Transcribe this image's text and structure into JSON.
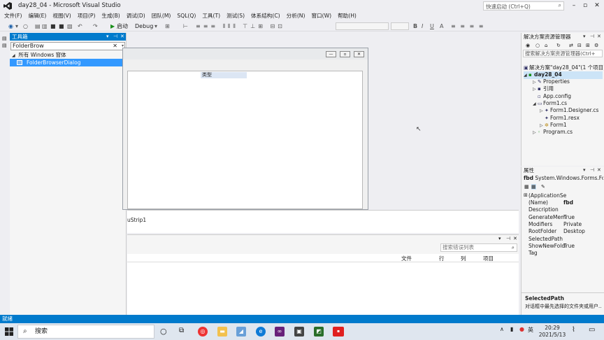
{
  "window": {
    "title": "day28_04 - Microsoft Visual Studio",
    "quick_launch_placeholder": "快速启动 (Ctrl+Q)"
  },
  "menu": [
    "文件(F)",
    "编辑(E)",
    "视图(V)",
    "项目(P)",
    "生成(B)",
    "调试(D)",
    "团队(M)",
    "SQL(Q)",
    "工具(T)",
    "测试(S)",
    "体系结构(C)",
    "分析(N)",
    "窗口(W)",
    "帮助(H)"
  ],
  "toolbar": {
    "start_label": "启动",
    "config": "Debug"
  },
  "toolbox": {
    "title": "工具箱",
    "search_value": "FolderBrow",
    "group": "所有 Windows 窗体",
    "item": "FolderBrowserDialog"
  },
  "designer": {
    "column_header": "类型",
    "component": "uStrip1"
  },
  "error_list": {
    "search_placeholder": "搜索错误列表",
    "columns": [
      "文件",
      "行",
      "列",
      "项目"
    ]
  },
  "solution_explorer": {
    "title": "解决方案资源管理器",
    "search_placeholder": "搜索解决方案资源管理器(Ctrl+",
    "items": [
      "解决方案\"day28_04\"(1 个项目)",
      "day28_04",
      "Properties",
      "引用",
      "App.config",
      "Form1.cs",
      "Form1.Designer.cs",
      "Form1.resx",
      "Form1",
      "Program.cs"
    ]
  },
  "properties": {
    "title": "属性",
    "object": "fbd",
    "object_type": "System.Windows.Forms.Fol",
    "rows": [
      {
        "name": "(ApplicationSe",
        "value": ""
      },
      {
        "name": "(Name)",
        "value": "fbd"
      },
      {
        "name": "Description",
        "value": ""
      },
      {
        "name": "GenerateMem",
        "value": "True"
      },
      {
        "name": "Modifiers",
        "value": "Private"
      },
      {
        "name": "RootFolder",
        "value": "Desktop"
      },
      {
        "name": "SelectedPath",
        "value": ""
      },
      {
        "name": "ShowNewFold",
        "value": "True"
      },
      {
        "name": "Tag",
        "value": ""
      }
    ],
    "desc_title": "SelectedPath",
    "desc_text": "对话框中最先选择的文件夹或用户..."
  },
  "status": {
    "text": "就绪"
  },
  "taskbar": {
    "search_label": "搜索",
    "time": "20:29",
    "date": "2021/5/13",
    "ime": "英"
  },
  "colors": {
    "accent": "#007acc",
    "selection": "#3399ff"
  }
}
